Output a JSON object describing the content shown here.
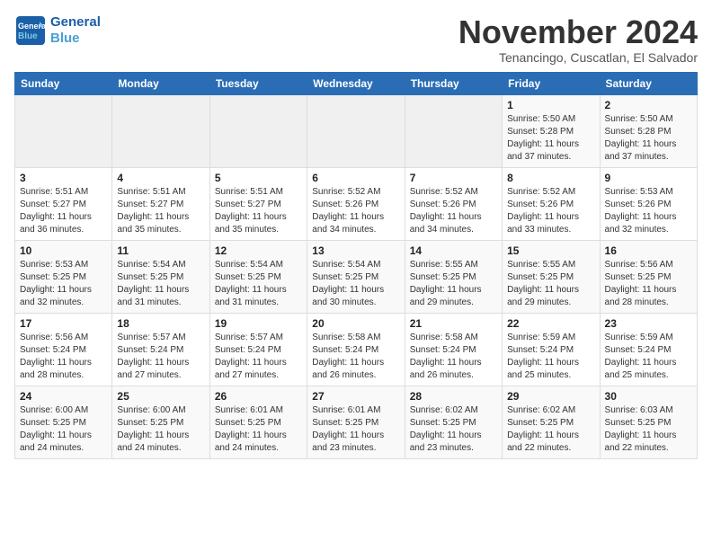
{
  "header": {
    "logo_line1": "General",
    "logo_line2": "Blue",
    "month_title": "November 2024",
    "location": "Tenancingo, Cuscatlan, El Salvador"
  },
  "weekdays": [
    "Sunday",
    "Monday",
    "Tuesday",
    "Wednesday",
    "Thursday",
    "Friday",
    "Saturday"
  ],
  "weeks": [
    [
      {
        "day": "",
        "info": ""
      },
      {
        "day": "",
        "info": ""
      },
      {
        "day": "",
        "info": ""
      },
      {
        "day": "",
        "info": ""
      },
      {
        "day": "",
        "info": ""
      },
      {
        "day": "1",
        "info": "Sunrise: 5:50 AM\nSunset: 5:28 PM\nDaylight: 11 hours and 37 minutes."
      },
      {
        "day": "2",
        "info": "Sunrise: 5:50 AM\nSunset: 5:28 PM\nDaylight: 11 hours and 37 minutes."
      }
    ],
    [
      {
        "day": "3",
        "info": "Sunrise: 5:51 AM\nSunset: 5:27 PM\nDaylight: 11 hours and 36 minutes."
      },
      {
        "day": "4",
        "info": "Sunrise: 5:51 AM\nSunset: 5:27 PM\nDaylight: 11 hours and 35 minutes."
      },
      {
        "day": "5",
        "info": "Sunrise: 5:51 AM\nSunset: 5:27 PM\nDaylight: 11 hours and 35 minutes."
      },
      {
        "day": "6",
        "info": "Sunrise: 5:52 AM\nSunset: 5:26 PM\nDaylight: 11 hours and 34 minutes."
      },
      {
        "day": "7",
        "info": "Sunrise: 5:52 AM\nSunset: 5:26 PM\nDaylight: 11 hours and 34 minutes."
      },
      {
        "day": "8",
        "info": "Sunrise: 5:52 AM\nSunset: 5:26 PM\nDaylight: 11 hours and 33 minutes."
      },
      {
        "day": "9",
        "info": "Sunrise: 5:53 AM\nSunset: 5:26 PM\nDaylight: 11 hours and 32 minutes."
      }
    ],
    [
      {
        "day": "10",
        "info": "Sunrise: 5:53 AM\nSunset: 5:25 PM\nDaylight: 11 hours and 32 minutes."
      },
      {
        "day": "11",
        "info": "Sunrise: 5:54 AM\nSunset: 5:25 PM\nDaylight: 11 hours and 31 minutes."
      },
      {
        "day": "12",
        "info": "Sunrise: 5:54 AM\nSunset: 5:25 PM\nDaylight: 11 hours and 31 minutes."
      },
      {
        "day": "13",
        "info": "Sunrise: 5:54 AM\nSunset: 5:25 PM\nDaylight: 11 hours and 30 minutes."
      },
      {
        "day": "14",
        "info": "Sunrise: 5:55 AM\nSunset: 5:25 PM\nDaylight: 11 hours and 29 minutes."
      },
      {
        "day": "15",
        "info": "Sunrise: 5:55 AM\nSunset: 5:25 PM\nDaylight: 11 hours and 29 minutes."
      },
      {
        "day": "16",
        "info": "Sunrise: 5:56 AM\nSunset: 5:25 PM\nDaylight: 11 hours and 28 minutes."
      }
    ],
    [
      {
        "day": "17",
        "info": "Sunrise: 5:56 AM\nSunset: 5:24 PM\nDaylight: 11 hours and 28 minutes."
      },
      {
        "day": "18",
        "info": "Sunrise: 5:57 AM\nSunset: 5:24 PM\nDaylight: 11 hours and 27 minutes."
      },
      {
        "day": "19",
        "info": "Sunrise: 5:57 AM\nSunset: 5:24 PM\nDaylight: 11 hours and 27 minutes."
      },
      {
        "day": "20",
        "info": "Sunrise: 5:58 AM\nSunset: 5:24 PM\nDaylight: 11 hours and 26 minutes."
      },
      {
        "day": "21",
        "info": "Sunrise: 5:58 AM\nSunset: 5:24 PM\nDaylight: 11 hours and 26 minutes."
      },
      {
        "day": "22",
        "info": "Sunrise: 5:59 AM\nSunset: 5:24 PM\nDaylight: 11 hours and 25 minutes."
      },
      {
        "day": "23",
        "info": "Sunrise: 5:59 AM\nSunset: 5:24 PM\nDaylight: 11 hours and 25 minutes."
      }
    ],
    [
      {
        "day": "24",
        "info": "Sunrise: 6:00 AM\nSunset: 5:25 PM\nDaylight: 11 hours and 24 minutes."
      },
      {
        "day": "25",
        "info": "Sunrise: 6:00 AM\nSunset: 5:25 PM\nDaylight: 11 hours and 24 minutes."
      },
      {
        "day": "26",
        "info": "Sunrise: 6:01 AM\nSunset: 5:25 PM\nDaylight: 11 hours and 24 minutes."
      },
      {
        "day": "27",
        "info": "Sunrise: 6:01 AM\nSunset: 5:25 PM\nDaylight: 11 hours and 23 minutes."
      },
      {
        "day": "28",
        "info": "Sunrise: 6:02 AM\nSunset: 5:25 PM\nDaylight: 11 hours and 23 minutes."
      },
      {
        "day": "29",
        "info": "Sunrise: 6:02 AM\nSunset: 5:25 PM\nDaylight: 11 hours and 22 minutes."
      },
      {
        "day": "30",
        "info": "Sunrise: 6:03 AM\nSunset: 5:25 PM\nDaylight: 11 hours and 22 minutes."
      }
    ]
  ]
}
